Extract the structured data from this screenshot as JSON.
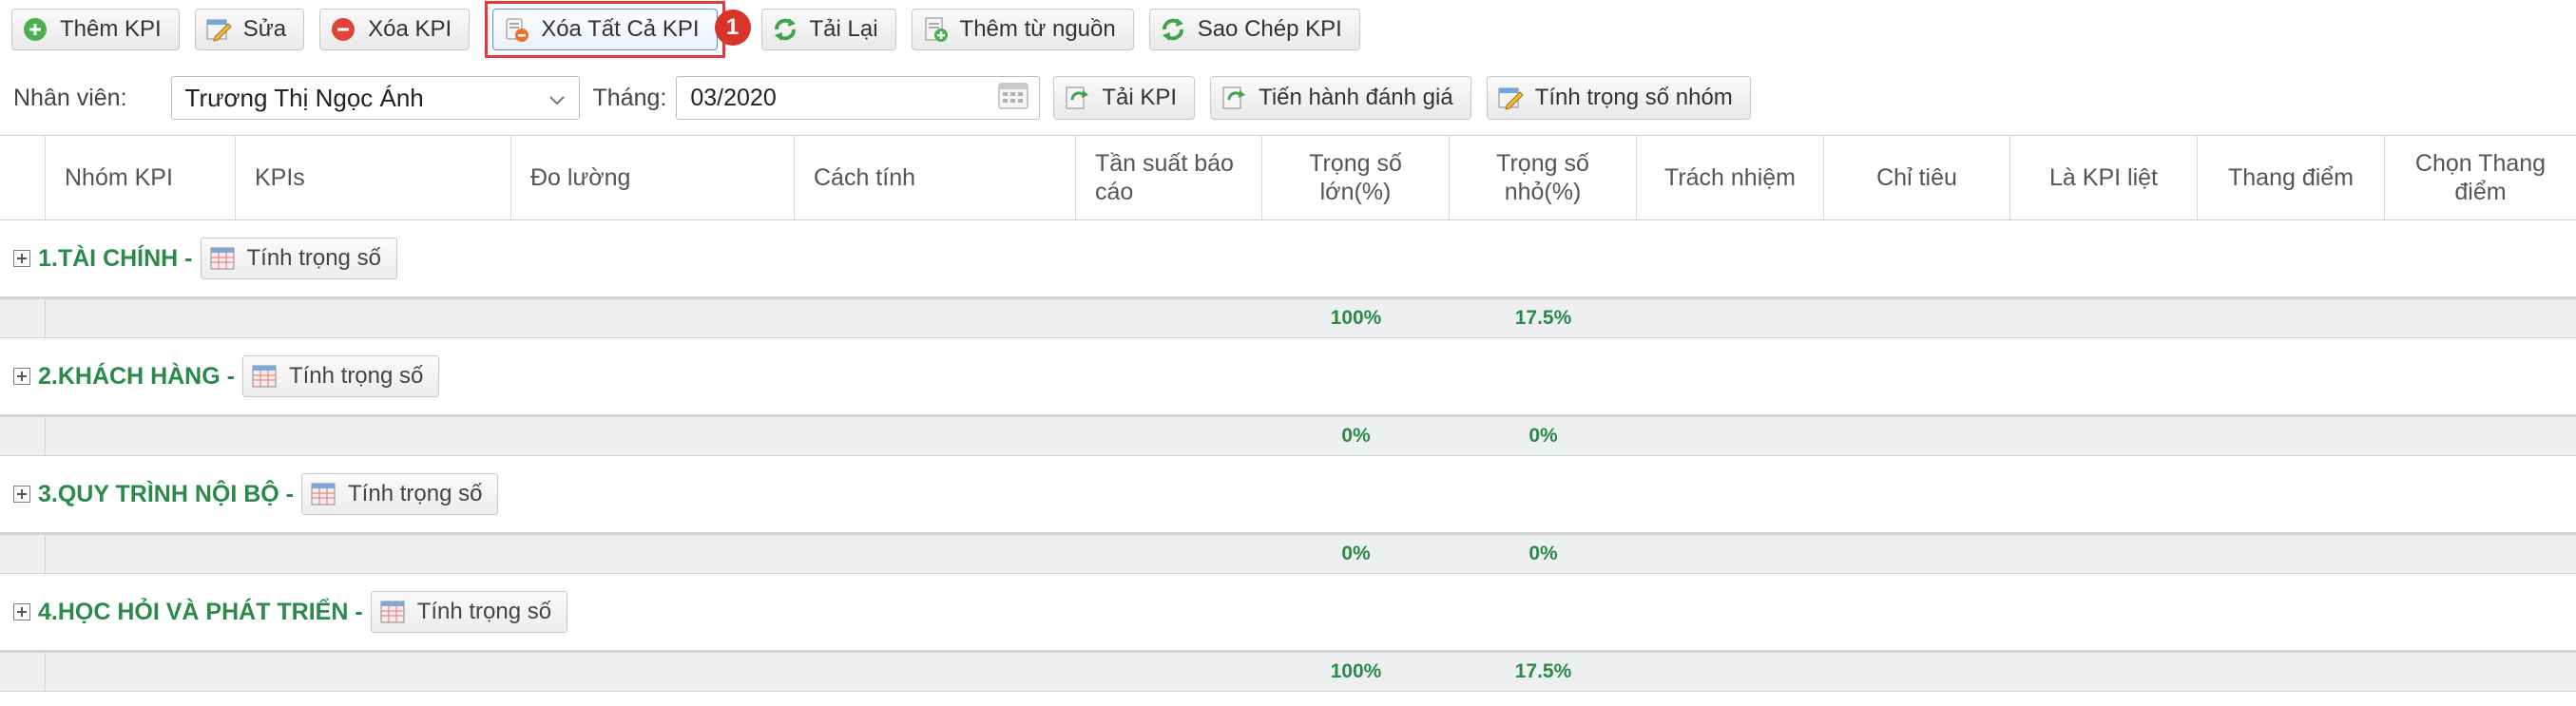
{
  "toolbar": {
    "add_kpi": "Thêm KPI",
    "edit": "Sửa",
    "delete_kpi": "Xóa KPI",
    "delete_all_kpi": "Xóa Tất Cả KPI",
    "step_number": "1",
    "reload": "Tải Lại",
    "add_from_source": "Thêm từ nguồn",
    "copy_kpi": "Sao Chép KPI"
  },
  "filters": {
    "employee_label": "Nhân viên:",
    "employee_value": "Trương Thị Ngọc Ánh",
    "month_label": "Tháng:",
    "month_value": "03/2020",
    "load_kpi": "Tải KPI",
    "evaluate": "Tiến hành đánh giá",
    "group_weight": "Tính trọng số nhóm"
  },
  "grid": {
    "columns": [
      "Nhóm KPI",
      "KPIs",
      "Đo lường",
      "Cách tính",
      "Tần suất báo cáo",
      "Trọng số lớn(%)",
      "Trọng số nhỏ(%)",
      "Trách nhiệm",
      "Chỉ tiêu",
      "Là KPI liệt",
      "Thang điểm",
      "Chọn Thang điểm"
    ],
    "calc_weight_label": "Tính trọng số",
    "groups": [
      {
        "title": "1.TÀI CHÍNH -",
        "weight_large": "100%",
        "weight_small": "17.5%"
      },
      {
        "title": "2.KHÁCH HÀNG -",
        "weight_large": "0%",
        "weight_small": "0%"
      },
      {
        "title": "3.QUY TRÌNH NỘI BỘ -",
        "weight_large": "0%",
        "weight_small": "0%"
      },
      {
        "title": "4.HỌC HỎI VÀ PHÁT TRIỂN -",
        "weight_large": "100%",
        "weight_small": "17.5%"
      }
    ]
  },
  "colors": {
    "accent_green": "#2a8a4a",
    "highlight_red": "#e03c3c"
  }
}
